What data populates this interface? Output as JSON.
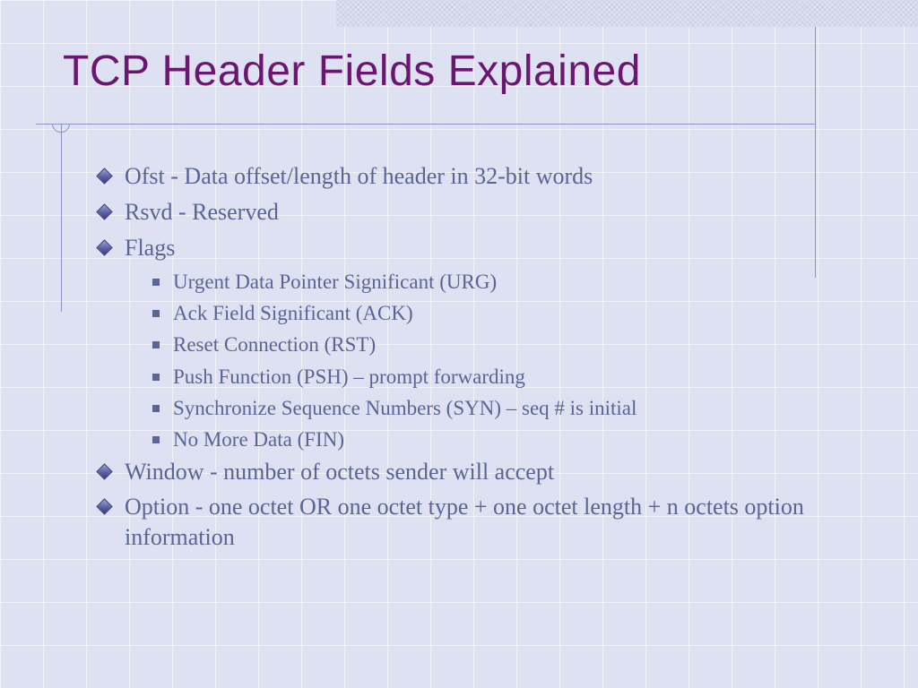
{
  "title": "TCP Header Fields Explained",
  "bullets": {
    "b0": "Ofst - Data offset/length of header in 32-bit words",
    "b1": "Rsvd - Reserved",
    "b2": "Flags",
    "b3": "Window - number of octets sender will accept",
    "b4": "Option - one octet OR one octet type + one octet length + n octets option information"
  },
  "flags": {
    "f0": "Urgent Data Pointer Significant (URG)",
    "f1": "Ack Field Significant (ACK)",
    "f2": "Reset Connection (RST)",
    "f3": "Push Function (PSH) – prompt forwarding",
    "f4": "Synchronize Sequence Numbers (SYN) – seq # is initial",
    "f5": "No More Data (FIN)"
  }
}
